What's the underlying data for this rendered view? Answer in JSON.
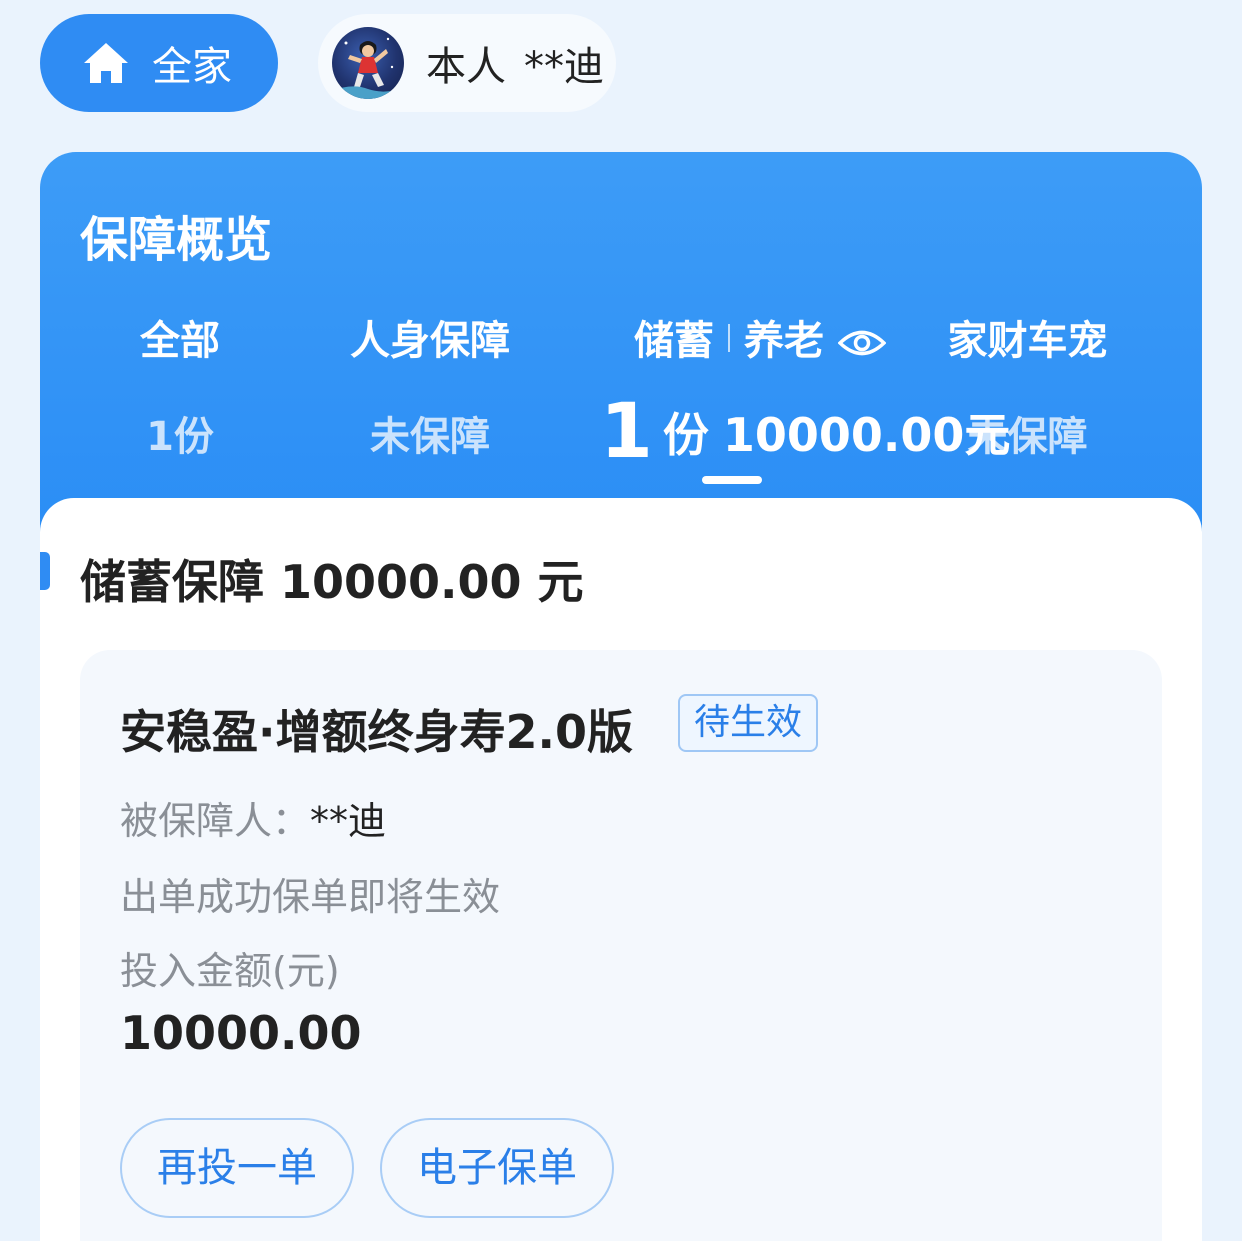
{
  "top_tabs": {
    "family_label": "全家",
    "self": {
      "relation": "本人",
      "name": "**迪"
    }
  },
  "overview": {
    "title": "保障概览",
    "tabs": [
      {
        "label": "全部",
        "value": "1份"
      },
      {
        "label": "人身保障",
        "value": "未保障"
      },
      {
        "label_a": "储蓄",
        "label_b": "养老",
        "count": "1",
        "count_unit": "份",
        "amount": "10000.00元"
      },
      {
        "label": "家财车宠",
        "value": "未保障"
      }
    ]
  },
  "section": {
    "title": "储蓄保障 10000.00 元"
  },
  "policy": {
    "name": "安稳盈·增额终身寿2.0版",
    "status": "待生效",
    "insured_label": "被保障人：",
    "insured_name": "**迪",
    "note": "出单成功保单即将生效",
    "amount_label": "投入金额(元)",
    "amount_value": "10000.00",
    "buttons": {
      "reinvest": "再投一单",
      "epolicy": "电子保单"
    }
  },
  "colors": {
    "brand_blue": "#2f8cf3",
    "background": "#eaf3fd",
    "badge_text": "#2a7fe8"
  },
  "icons": [
    "home-icon",
    "eye-icon",
    "avatar"
  ]
}
